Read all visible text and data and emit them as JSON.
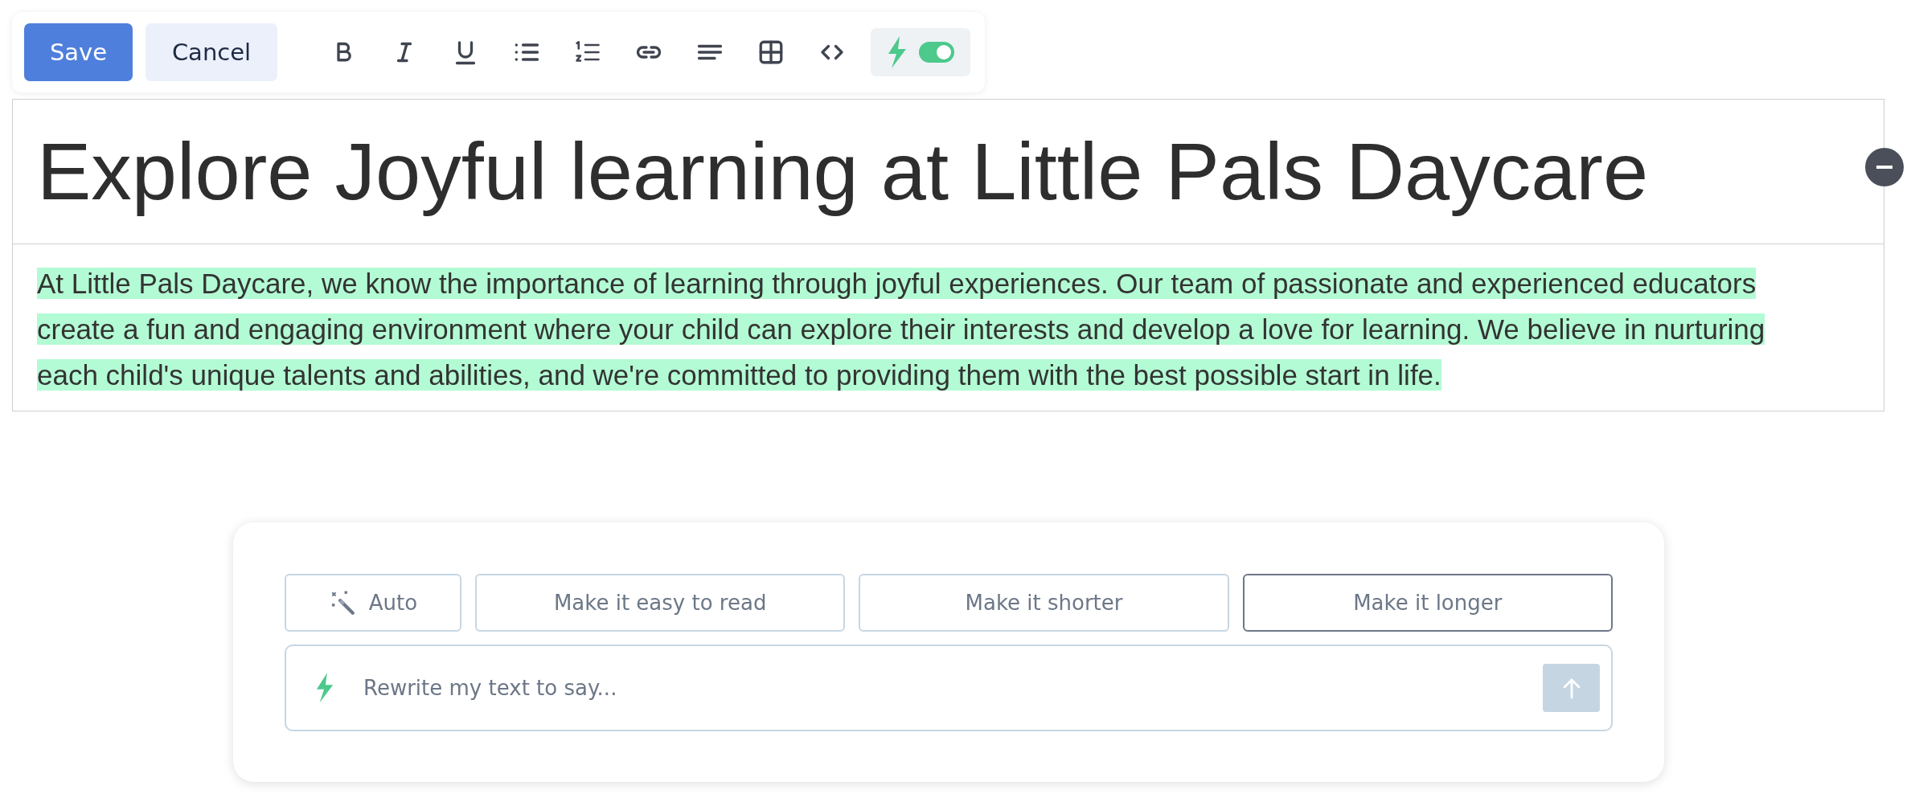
{
  "toolbar": {
    "save": "Save",
    "cancel": "Cancel",
    "format_buttons": [
      {
        "kind": "bold"
      },
      {
        "kind": "italic"
      },
      {
        "kind": "underline"
      },
      {
        "kind": "bullets"
      },
      {
        "kind": "numbers"
      },
      {
        "kind": "link"
      },
      {
        "kind": "align"
      },
      {
        "kind": "table"
      },
      {
        "kind": "code"
      }
    ],
    "ai_toggle": {
      "on": true
    }
  },
  "title": "Explore Joyful learning at Little Pals Daycare",
  "paragraph": {
    "text": "At Little Pals Daycare, we know the importance of learning through joyful experiences. Our team of passionate and experienced educators create a fun and engaging environment where your child can explore their interests and develop a love for learning. We believe in nurturing each child's unique talents and abilities, and we're committed to providing them with the best possible start in life.",
    "selected": true
  },
  "ai_panel": {
    "suggestions": [
      {
        "kind": "auto",
        "label": "Auto",
        "selected": false
      },
      {
        "kind": "text",
        "label": "Make it easy to read",
        "selected": false
      },
      {
        "kind": "text",
        "label": "Make it shorter",
        "selected": false
      },
      {
        "kind": "text",
        "label": "Make it longer",
        "selected": true
      }
    ],
    "prompt": {
      "placeholder": "Rewrite my text to say..."
    },
    "send": {
      "disabled": true
    }
  }
}
